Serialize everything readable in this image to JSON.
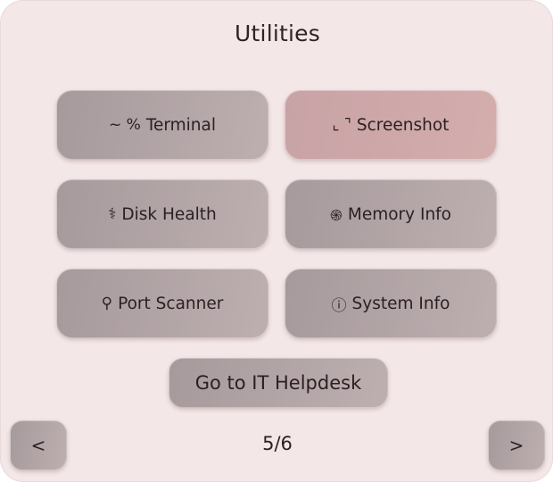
{
  "title": "Utilities",
  "tiles": [
    {
      "icon": "~ %",
      "icon_name": "terminal-icon",
      "label": "Terminal"
    },
    {
      "icon": "⌞ ⌝",
      "icon_name": "screenshot-icon",
      "label": "Screenshot"
    },
    {
      "icon": "⚕",
      "icon_name": "disk-health-icon",
      "label": "Disk Health"
    },
    {
      "icon": "֍",
      "icon_name": "memory-icon",
      "label": "Memory Info"
    },
    {
      "icon": "⚲",
      "icon_name": "port-scanner-icon",
      "label": "Port Scanner"
    },
    {
      "icon": "ⓘ",
      "icon_name": "info-icon",
      "label": "System Info"
    }
  ],
  "helpdesk_label": "Go to IT Helpdesk",
  "nav": {
    "prev_label": "<",
    "next_label": ">",
    "page_indicator": "5/6"
  },
  "colors": {
    "panel_bg": "#f4e7e7",
    "tile": "#b2a5a6",
    "tile_accent": "#cfa9a9",
    "text": "#2b2024"
  }
}
